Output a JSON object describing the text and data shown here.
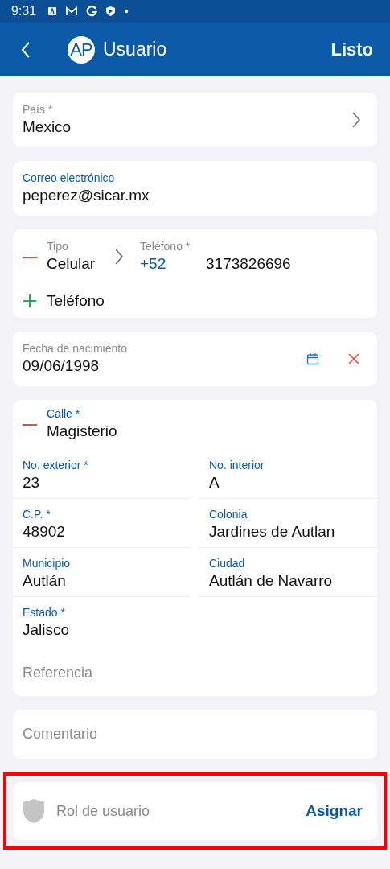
{
  "status_bar": {
    "time": "9:31"
  },
  "app_bar": {
    "avatar": "AP",
    "title": "Usuario",
    "action": "Listo"
  },
  "cards": [
    {
      "kind": "select",
      "label": "País *",
      "label_accent": false,
      "value": "Mexico"
    },
    {
      "kind": "text",
      "label": "Correo electrónico",
      "label_accent": true,
      "value": "peperez@sicar.mx"
    },
    {
      "kind": "phones",
      "phones": [
        {
          "type_label": "Tipo",
          "type": "Celular",
          "number_label": "Teléfono *",
          "code": "+52",
          "number": "3173826696"
        }
      ],
      "add_label": "Teléfono"
    },
    {
      "kind": "date",
      "label": "Fecha de nacimiento",
      "label_accent": false,
      "value": "09/06/1998"
    },
    {
      "kind": "address",
      "street": {
        "label": "Calle *",
        "value": "Magisterio"
      },
      "fields": [
        {
          "label": "No. exterior *",
          "value": "23"
        },
        {
          "label": "No. interior",
          "value": "A"
        },
        {
          "label": "C.P. *",
          "value": "48902"
        },
        {
          "label": "Colonia",
          "value": "Jardines de Autlan"
        },
        {
          "label": "Municipio",
          "value": "Autlán"
        },
        {
          "label": "Ciudad",
          "value": "Autlán de Navarro"
        },
        {
          "label": "Estado *",
          "value": "Jalisco"
        }
      ],
      "reference": {
        "placeholder": "Referencia"
      }
    },
    {
      "kind": "comment",
      "placeholder": "Comentario"
    },
    {
      "kind": "role",
      "placeholder": "Rol de usuario",
      "action": "Asignar",
      "highlighted": true
    }
  ]
}
